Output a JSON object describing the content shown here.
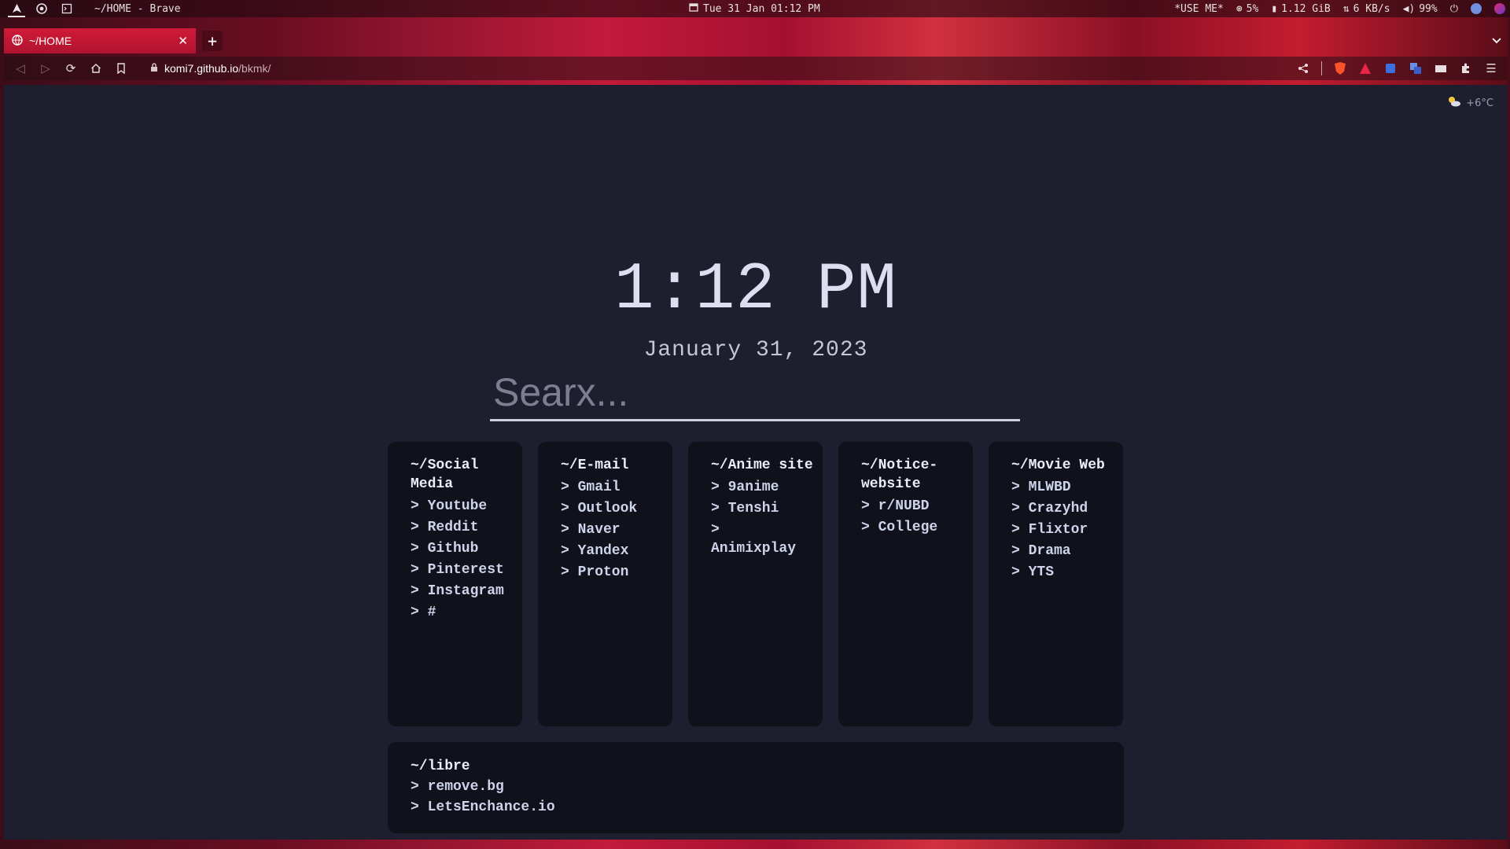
{
  "system_bar": {
    "window_title": "~/HOME - Brave",
    "datetime": "Tue 31 Jan 01:12 PM",
    "use_me": "*USE ME*",
    "cpu": "5%",
    "memory": "1.12 GiB",
    "network": "6 KB/s",
    "volume": "99%"
  },
  "browser": {
    "tab_title": "~/HOME",
    "url_host": "komi7.github.io",
    "url_path": "/bkmk/"
  },
  "page": {
    "weather": "+6°C",
    "clock": "1:12 PM",
    "date": "January 31, 2023",
    "search_placeholder": "Searx...",
    "cards": [
      {
        "title": "~/Social Media",
        "links": [
          "> Youtube",
          "> Reddit",
          "> Github",
          "> Pinterest",
          "> Instagram",
          "> #"
        ]
      },
      {
        "title": "~/E-mail",
        "links": [
          "> Gmail",
          "> Outlook",
          "> Naver",
          "> Yandex",
          "> Proton"
        ]
      },
      {
        "title": "~/Anime site",
        "links": [
          "> 9anime",
          "> Tenshi",
          "> Animixplay"
        ]
      },
      {
        "title": "~/Notice-website",
        "links": [
          "> r/NUBD",
          "> College"
        ]
      },
      {
        "title": "~/Movie Web",
        "links": [
          "> MLWBD",
          "> Crazyhd",
          "> Flixtor",
          "> Drama",
          "> YTS"
        ]
      }
    ],
    "libre": {
      "title": "~/libre",
      "links": [
        "> remove.bg",
        "> LetsEnchance.io"
      ]
    }
  }
}
